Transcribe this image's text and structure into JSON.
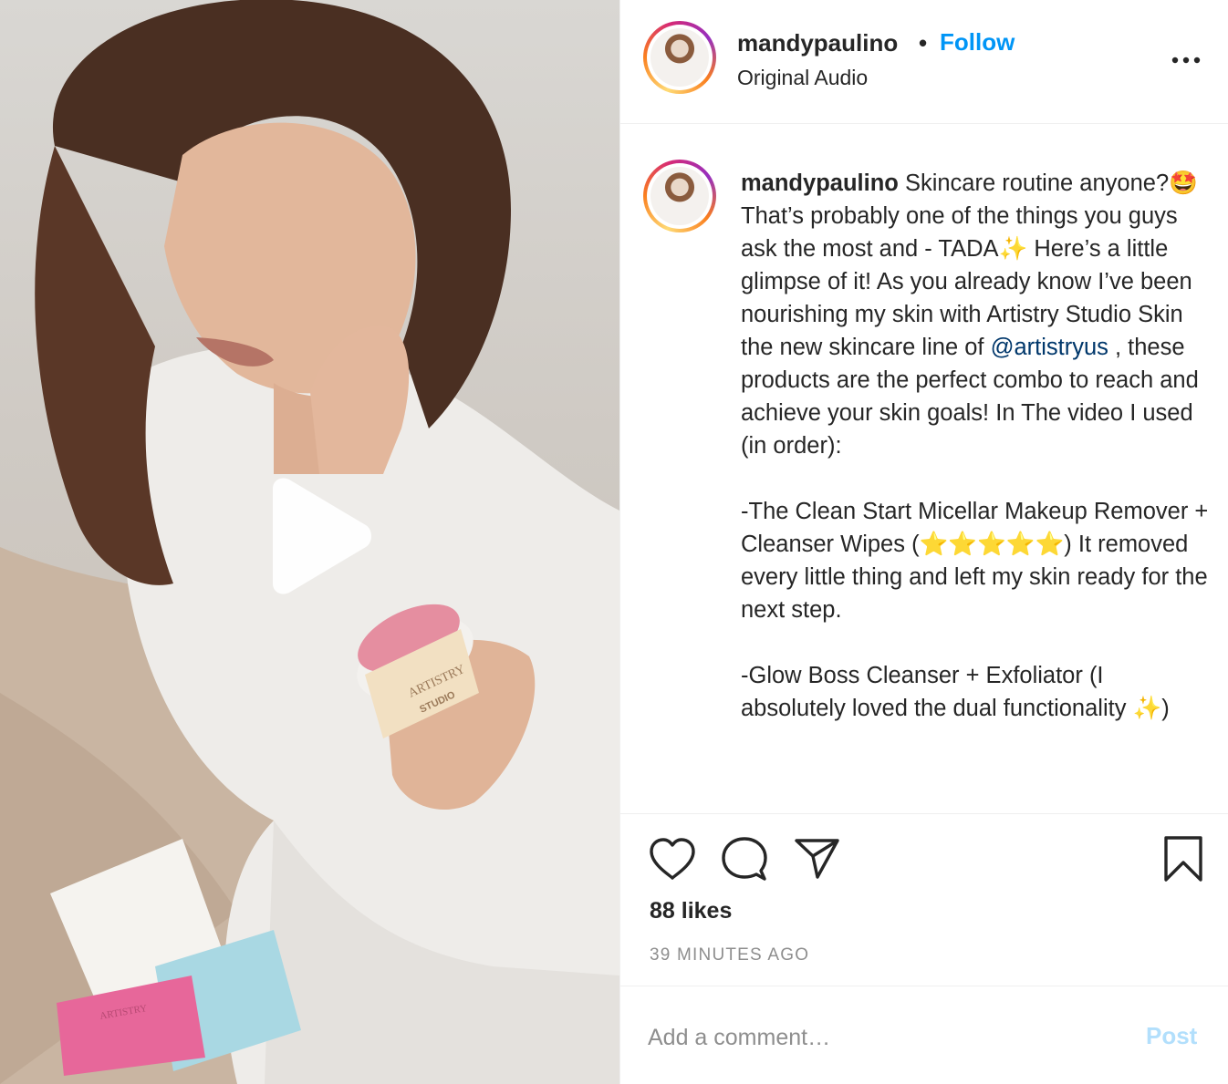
{
  "post": {
    "username": "mandypaulino",
    "separator": "•",
    "follow_label": "Follow",
    "audio_label": "Original Audio",
    "more_icon": "more-horizontal-icon",
    "media_type": "video",
    "play_icon": "play-icon",
    "media_text": {
      "jar_brand": "ARTISTRY",
      "jar_sub": "STUDIO",
      "packet_brand": "ARTISTRY"
    }
  },
  "caption": {
    "username": "mandypaulino",
    "text_1": " Skincare routine anyone?🤩 That’s probably one of the things you guys ask the most and - TADA✨ Here’s a little glimpse of it! As you already know I’ve been nourishing my skin with Artistry Studio Skin the new skincare line of ",
    "mention": "@artistryus",
    "text_2": " , these products are the perfect combo to reach and achieve your skin goals! In The video I used (in order):\n\n-The Clean Start Micellar Makeup Remover + Cleanser Wipes (⭐⭐⭐⭐⭐) It removed every little thing and left my skin ready for the next step.\n\n-Glow Boss Cleanser + Exfoliator (I absolutely loved the dual functionality ✨)"
  },
  "actions": {
    "like_icon": "heart-icon",
    "comment_icon": "comment-icon",
    "share_icon": "paper-plane-icon",
    "save_icon": "bookmark-icon",
    "likes": "88 likes",
    "timestamp": "39 MINUTES AGO"
  },
  "comment": {
    "placeholder": "Add a comment…",
    "post_label": "Post"
  },
  "colors": {
    "link_blue": "#0095f6",
    "post_disabled": "#b2dffc",
    "mention": "#00376b",
    "muted": "#8e8e8e",
    "text": "#262626"
  }
}
